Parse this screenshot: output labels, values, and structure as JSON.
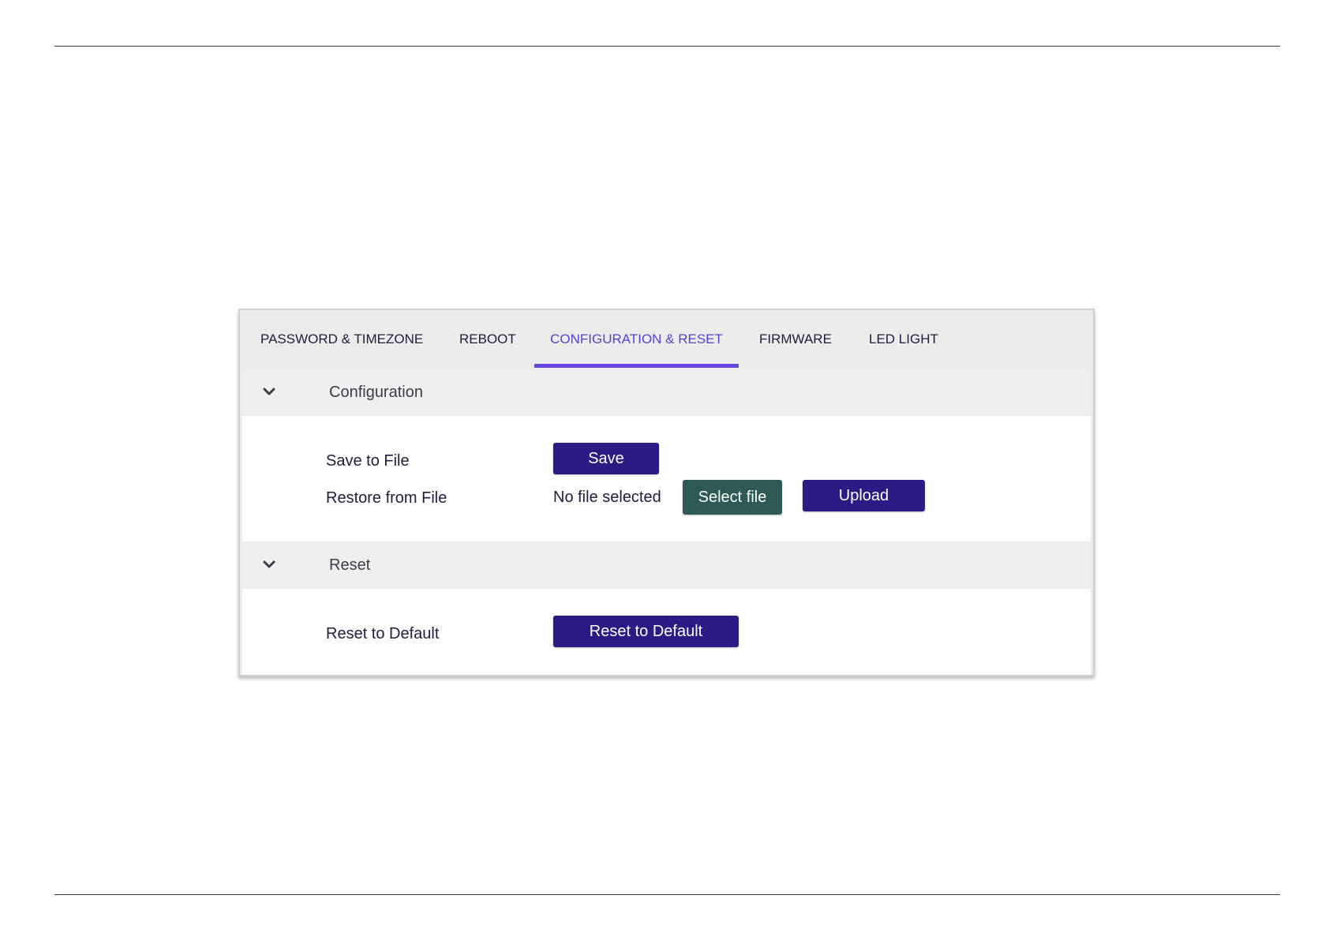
{
  "tabs": [
    {
      "label": "PASSWORD & TIMEZONE",
      "active": false
    },
    {
      "label": "REBOOT",
      "active": false
    },
    {
      "label": "CONFIGURATION & RESET",
      "active": true
    },
    {
      "label": "FIRMWARE",
      "active": false
    },
    {
      "label": "LED LIGHT",
      "active": false
    }
  ],
  "sections": {
    "configuration": {
      "title": "Configuration",
      "save_row": {
        "label": "Save to File",
        "button": "Save"
      },
      "restore_row": {
        "label": "Restore from File",
        "file_status": "No file selected",
        "select_button": "Select file",
        "upload_button": "Upload"
      }
    },
    "reset": {
      "title": "Reset",
      "reset_row": {
        "label": "Reset to Default",
        "button": "Reset to Default"
      }
    }
  },
  "icons": {
    "section_toggle": "chevron-down-icon"
  },
  "colors": {
    "accent": "#6a44e4",
    "active_tab_text": "#5b3fd3",
    "primary_button": "#2c1a85",
    "secondary_button": "#2e5a55"
  }
}
